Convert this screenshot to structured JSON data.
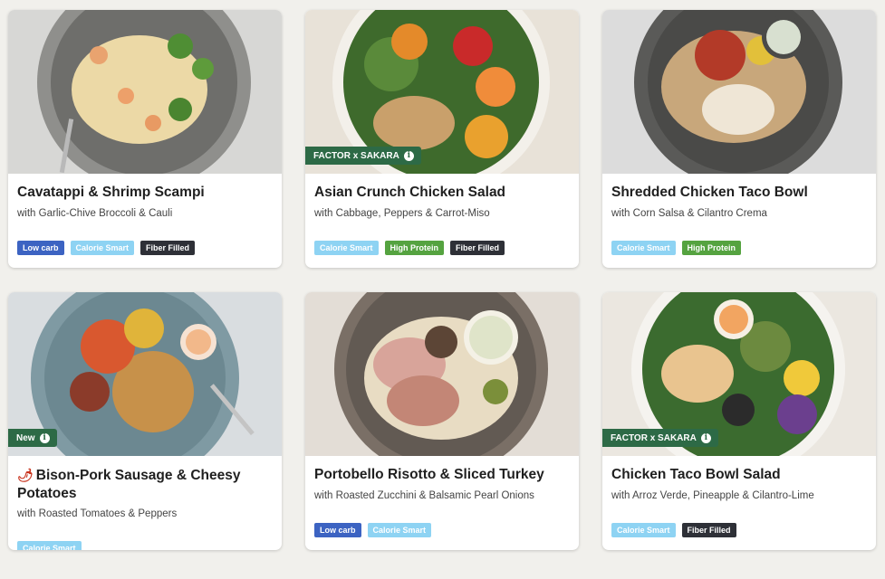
{
  "meals": [
    {
      "title": "Cavatappi & Shrimp Scampi",
      "subtitle": "with Garlic-Chive Broccoli & Cauli",
      "tags": [
        "Low carb",
        "Calorie Smart",
        "Fiber Filled"
      ],
      "badge": ""
    },
    {
      "title": "Asian Crunch Chicken Salad",
      "subtitle": "with Cabbage, Peppers & Carrot-Miso",
      "tags": [
        "Calorie Smart",
        "High Protein",
        "Fiber Filled"
      ],
      "badge": "FACTOR x SAKARA"
    },
    {
      "title": "Shredded Chicken Taco Bowl",
      "subtitle": "with Corn Salsa & Cilantro Crema",
      "tags": [
        "Calorie Smart",
        "High Protein"
      ],
      "badge": ""
    },
    {
      "title": "Bison-Pork Sausage & Cheesy Potatoes",
      "subtitle": "with Roasted Tomatoes & Peppers",
      "tags": [
        "Calorie Smart"
      ],
      "badge": "New",
      "icon": "chili-pepper-icon"
    },
    {
      "title": "Portobello Risotto & Sliced Turkey",
      "subtitle": "with Roasted Zucchini & Balsamic Pearl Onions",
      "tags": [
        "Low carb",
        "Calorie Smart"
      ],
      "badge": ""
    },
    {
      "title": "Chicken Taco Bowl Salad",
      "subtitle": "with Arroz Verde, Pineapple & Cilantro-Lime",
      "tags": [
        "Calorie Smart",
        "Fiber Filled"
      ],
      "badge": "FACTOR x SAKARA"
    }
  ],
  "colors": {
    "low_carb": "#3c63c2",
    "calorie_smart": "#8ed3f3",
    "fiber_filled": "#2e3037",
    "high_protein": "#55a340",
    "badge": "#2d6a46"
  }
}
